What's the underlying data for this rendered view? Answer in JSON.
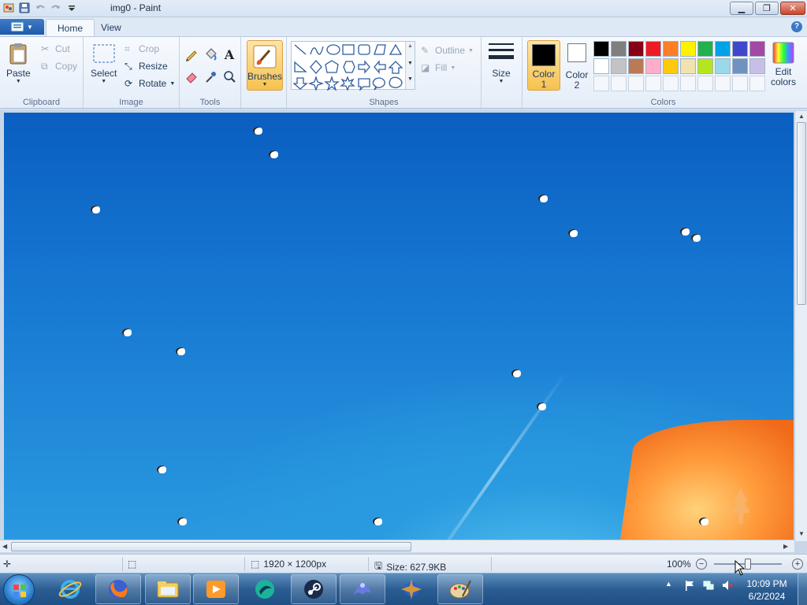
{
  "window": {
    "title": "img0 - Paint"
  },
  "tabs": {
    "file_icon": "paint-menu-icon",
    "home": "Home",
    "view": "View"
  },
  "ribbon": {
    "clipboard": {
      "label": "Clipboard",
      "paste": "Paste",
      "cut": "Cut",
      "copy": "Copy"
    },
    "image": {
      "label": "Image",
      "select": "Select",
      "crop": "Crop",
      "resize": "Resize",
      "rotate": "Rotate"
    },
    "tools": {
      "label": "Tools"
    },
    "brushes": {
      "label": "Brushes"
    },
    "shapes": {
      "label": "Shapes",
      "outline": "Outline",
      "fill": "Fill"
    },
    "size": {
      "label": "Size"
    },
    "colors": {
      "label": "Colors",
      "color1_line1": "Color",
      "color1_line2": "1",
      "color2_line1": "Color",
      "color2_line2": "2",
      "edit_line1": "Edit",
      "edit_line2": "colors",
      "color1_value": "#000000",
      "color2_value": "#ffffff",
      "palette_row1": [
        "#000000",
        "#7f7f7f",
        "#880015",
        "#ed1c24",
        "#ff7f27",
        "#fff200",
        "#22b14c",
        "#00a2e8",
        "#3f48cc",
        "#a349a4"
      ],
      "palette_row2": [
        "#ffffff",
        "#c3c3c3",
        "#b97a57",
        "#ffaec9",
        "#ffc90e",
        "#efe4b0",
        "#b5e61d",
        "#99d9ea",
        "#7092be",
        "#c8bfe7"
      ],
      "palette_row3": [
        "",
        "",
        "",
        "",
        "",
        "",
        "",
        "",
        "",
        ""
      ]
    }
  },
  "status": {
    "dimensions": "1920 × 1200px",
    "size": "Size: 627.9KB",
    "zoom": "100%",
    "zoom_fraction": 0.5
  },
  "taskbar": {
    "apps": [
      "internet-explorer-icon",
      "firefox-icon",
      "file-explorer-icon",
      "media-player-icon",
      "app-icon",
      "steam-icon",
      "app-icon-2",
      "app-icon-3",
      "paint-icon"
    ],
    "time": "10:09 PM",
    "date": "6/2/2024"
  }
}
